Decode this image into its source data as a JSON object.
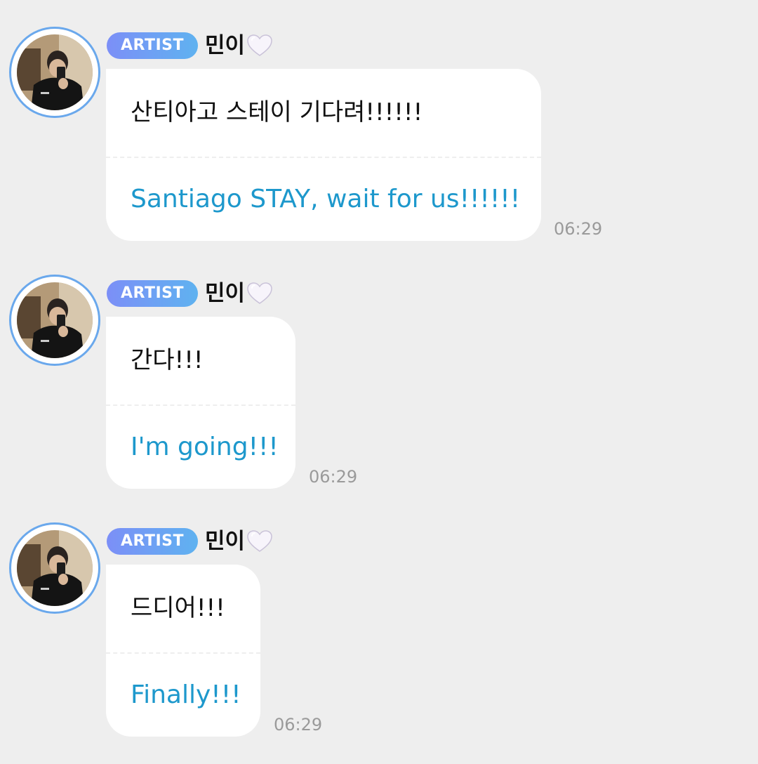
{
  "messages": [
    {
      "badge": "ARTIST",
      "sender": "민이",
      "heart_icon": "white-heart-icon",
      "korean": "산티아고 스테이 기다려!!!!!!",
      "english": "Santiago STAY, wait for us!!!!!!",
      "time": "06:29"
    },
    {
      "badge": "ARTIST",
      "sender": "민이",
      "heart_icon": "white-heart-icon",
      "korean": "간다!!!",
      "english": "I'm going!!!",
      "time": "06:29"
    },
    {
      "badge": "ARTIST",
      "sender": "민이",
      "heart_icon": "white-heart-icon",
      "korean": "드디어!!!",
      "english": "Finally!!!",
      "time": "06:29"
    }
  ],
  "colors": {
    "background": "#eeeeee",
    "bubble": "#ffffff",
    "translation_text": "#1d98cc",
    "timestamp": "#9a9a9a",
    "avatar_ring": "#6aa8ec",
    "badge_gradient_start": "#7c8ff7",
    "badge_gradient_end": "#5fb2f0"
  }
}
